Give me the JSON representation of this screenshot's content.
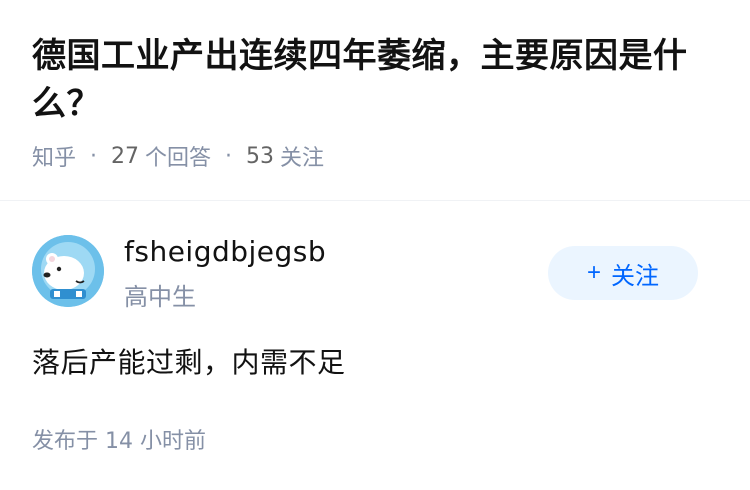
{
  "question": {
    "title": "德国工业产出连续四年萎缩，主要原因是什么？",
    "source": "知乎",
    "answer_count": "27",
    "answer_label": "个回答",
    "follow_count": "53",
    "follow_label": "关注"
  },
  "answer": {
    "author": {
      "name": "fsheigdbjegsb",
      "headline": "高中生",
      "avatar_icon": "polar-bear-avatar-icon"
    },
    "follow_button": {
      "icon": "+",
      "label": "关注"
    },
    "content": "落后产能过剩，内需不足",
    "published": "发布于 14 小时前"
  },
  "colors": {
    "title": "#121212",
    "meta": "#8590a6",
    "accent": "#0066ff",
    "follow_bg": "#ebf5ff",
    "avatar_bg": "#6cc0ea"
  }
}
